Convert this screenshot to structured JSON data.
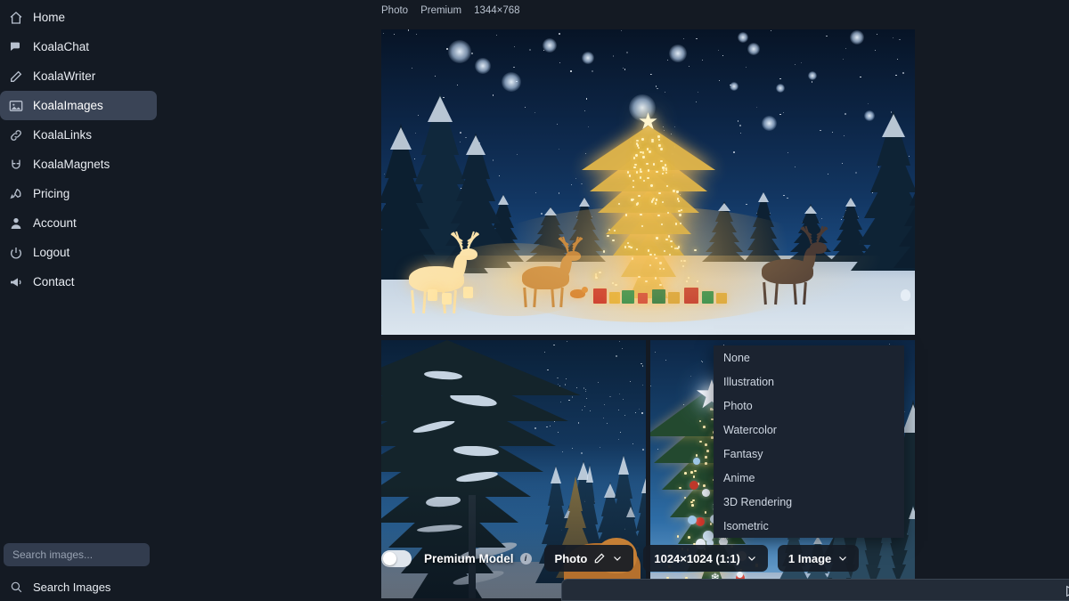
{
  "sidebar": {
    "items": [
      {
        "label": "Home",
        "icon": "home-icon",
        "active": false
      },
      {
        "label": "KoalaChat",
        "icon": "chat-icon",
        "active": false
      },
      {
        "label": "KoalaWriter",
        "icon": "pencil-edit-icon",
        "active": false
      },
      {
        "label": "KoalaImages",
        "icon": "image-icon",
        "active": true
      },
      {
        "label": "KoalaLinks",
        "icon": "link-icon",
        "active": false
      },
      {
        "label": "KoalaMagnets",
        "icon": "magnet-icon",
        "active": false
      },
      {
        "label": "Pricing",
        "icon": "rocket-icon",
        "active": false
      },
      {
        "label": "Account",
        "icon": "user-icon",
        "active": false
      },
      {
        "label": "Logout",
        "icon": "power-icon",
        "active": false
      },
      {
        "label": "Contact",
        "icon": "megaphone-icon",
        "active": false
      }
    ],
    "search_placeholder": "Search images...",
    "search_value": "",
    "search_row_label": "Search Images",
    "search_row_icon": "search-icon"
  },
  "meta": {
    "type": "Photo",
    "tier": "Premium",
    "dimensions": "1344×768"
  },
  "style_dropdown": {
    "options": [
      "None",
      "Illustration",
      "Photo",
      "Watercolor",
      "Fantasy",
      "Anime",
      "3D Rendering",
      "Isometric"
    ]
  },
  "controls": {
    "premium_toggle_label": "Premium Model",
    "premium_toggle_on": false,
    "info_icon": "info-icon",
    "style_pill": {
      "label": "Photo",
      "edit_icon": "pencil-edit-icon",
      "chevron": "chevron-down-icon"
    },
    "size_pill": {
      "label": "1024×1024 (1:1)",
      "chevron": "chevron-down-icon"
    },
    "count_pill": {
      "label": "1 Image",
      "chevron": "chevron-down-icon"
    }
  },
  "prompt": {
    "value": "",
    "send_icon": "send-icon"
  },
  "colors": {
    "app_background": "#141a23",
    "sidebar_active": "#3a4456",
    "search_field": "#323c4e",
    "dropdown_background": "#1b2330",
    "pill_background": "#161c26",
    "text_primary": "#e8ecf2",
    "text_muted": "#97a1b1"
  }
}
